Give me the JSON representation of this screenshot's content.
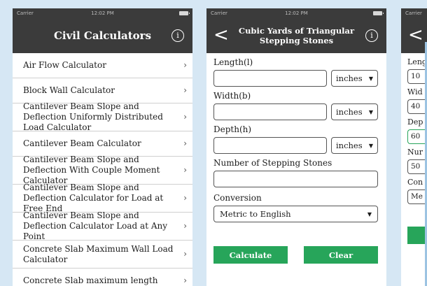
{
  "status_bar": {
    "carrier": "Carrier",
    "time": "12:02 PM"
  },
  "screen1": {
    "title": "Civil Calculators",
    "items": [
      {
        "label": "Air Flow Calculator"
      },
      {
        "label": "Block Wall Calculator"
      },
      {
        "label": "Cantilever Beam Slope and Deflection Uniformly Distributed Load Calculator"
      },
      {
        "label": "Cantilever Beam Calculator"
      },
      {
        "label": "Cantilever Beam Slope and Deflection With Couple Moment Calculator"
      },
      {
        "label": "Cantilever Beam Slope and Deflection Calculator for Load at Free End"
      },
      {
        "label": "Cantilever Beam Slope and Deflection Calculator Load at Any Point"
      },
      {
        "label": "Concrete Slab Maximum Wall Load Calculator"
      },
      {
        "label": "Concrete Slab maximum length"
      }
    ]
  },
  "screen2": {
    "title": "Cubic Yards of Triangular Stepping Stones",
    "length_label": "Length(l)",
    "length_value": "",
    "length_unit": "inches",
    "width_label": "Width(b)",
    "width_value": "",
    "width_unit": "inches",
    "depth_label": "Depth(h)",
    "depth_value": "",
    "depth_unit": "inches",
    "stones_label": "Number of Stepping Stones",
    "stones_value": "",
    "conversion_label": "Conversion",
    "conversion_value": "Metric to English",
    "calculate_label": "Calculate",
    "clear_label": "Clear"
  },
  "screen3": {
    "labels": [
      "Leng",
      "Wid",
      "Dep",
      "Nur",
      "Con"
    ],
    "values": [
      "10",
      "40",
      "60",
      "50",
      "Me"
    ]
  },
  "colors": {
    "nav": "#3b3b3b",
    "accent": "#27a55a",
    "background": "#d6e7f4"
  }
}
